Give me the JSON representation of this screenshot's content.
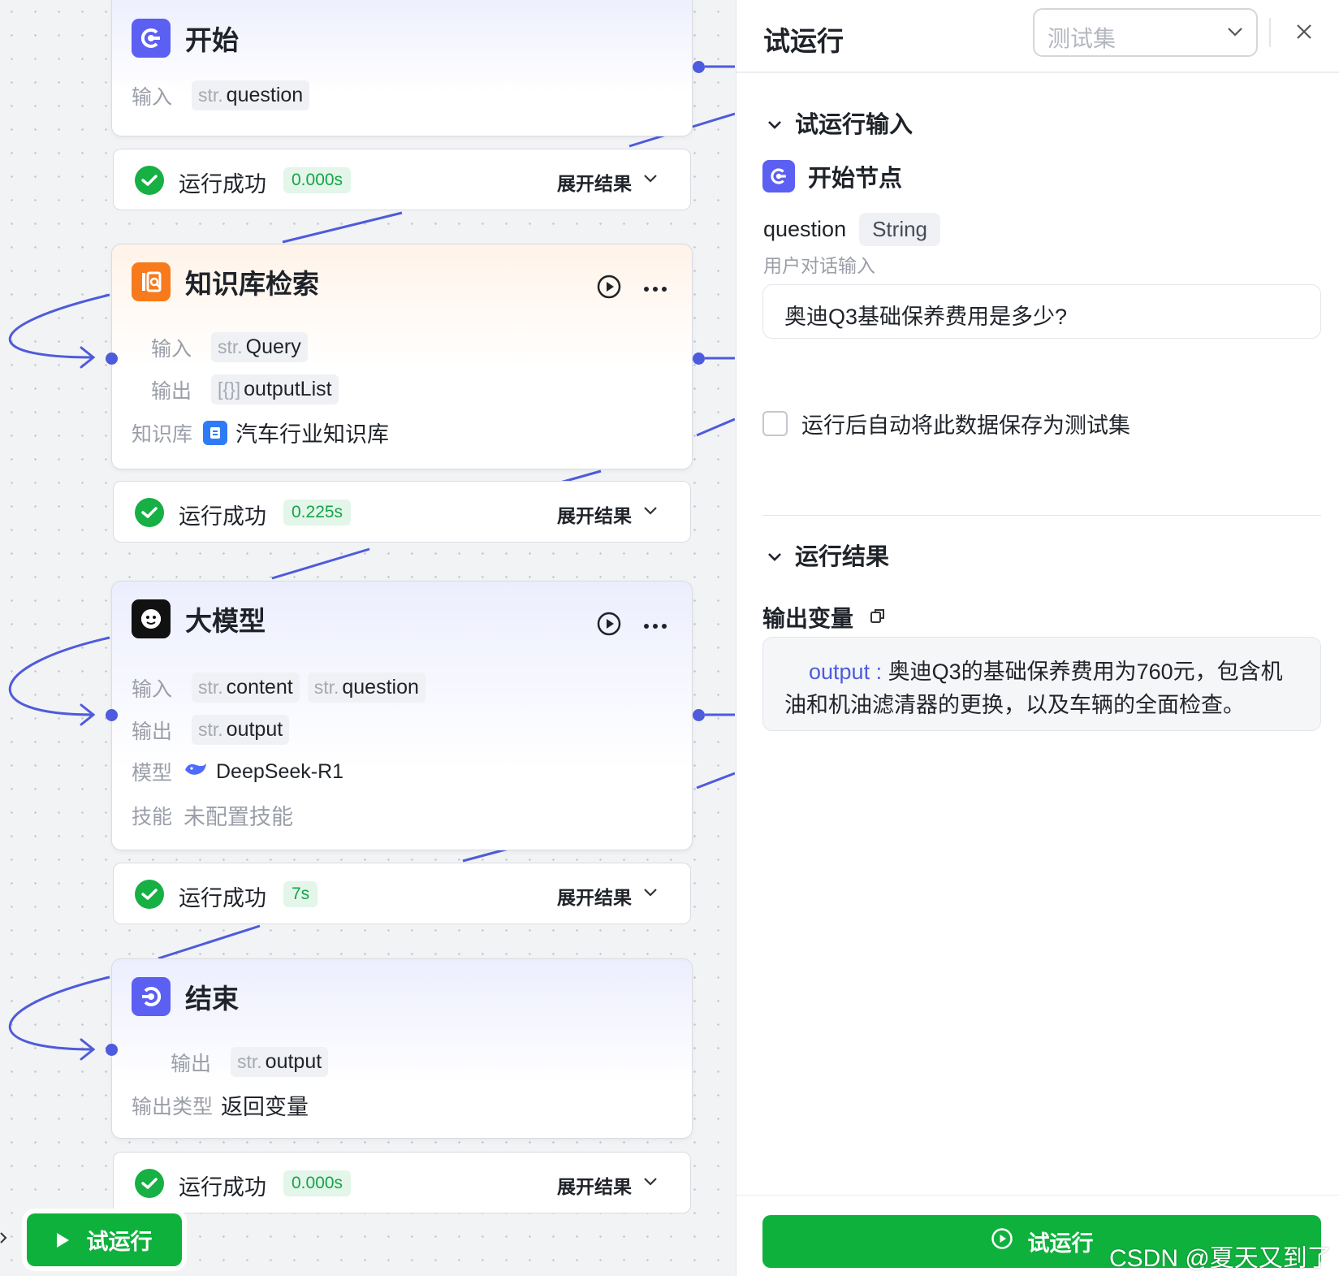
{
  "canvas": {
    "start": {
      "title": "开始",
      "input_label": "输入",
      "input_type": "str.",
      "input_name": "question"
    },
    "knowledge": {
      "title": "知识库检索",
      "input_label": "输入",
      "input_type": "str.",
      "input_name": "Query",
      "output_label": "输出",
      "output_type": "[{}]",
      "output_name": "outputList",
      "kb_label": "知识库",
      "kb_name": "汽车行业知识库"
    },
    "llm": {
      "title": "大模型",
      "input_label": "输入",
      "input_type_1": "str.",
      "input_name_1": "content",
      "input_type_2": "str.",
      "input_name_2": "question",
      "output_label": "输出",
      "output_type": "str.",
      "output_name": "output",
      "model_label": "模型",
      "model_name": "DeepSeek-R1",
      "skill_label": "技能",
      "skill_value": "未配置技能"
    },
    "end": {
      "title": "结束",
      "output_label": "输出",
      "output_type": "str.",
      "output_name": "output",
      "type_label": "输出类型",
      "type_value": "返回变量"
    },
    "statuses": [
      {
        "text": "运行成功",
        "time": "0.000s",
        "expand": "展开结果"
      },
      {
        "text": "运行成功",
        "time": "0.225s",
        "expand": "展开结果"
      },
      {
        "text": "运行成功",
        "time": "7s",
        "expand": "展开结果"
      },
      {
        "text": "运行成功",
        "time": "0.000s",
        "expand": "展开结果"
      }
    ],
    "run_button": "试运行"
  },
  "panel": {
    "title": "试运行",
    "testset_placeholder": "测试集",
    "input_section": "试运行输入",
    "start_node_label": "开始节点",
    "field_name": "question",
    "field_type": "String",
    "field_desc": "用户对话输入",
    "field_value": "奥迪Q3基础保养费用是多少?",
    "autosave_label": "运行后自动将此数据保存为测试集",
    "result_section": "运行结果",
    "output_var_label": "输出变量",
    "output_key": "output",
    "output_sep": " : ",
    "output_value": "奥迪Q3的基础保养费用为760元，包含机油和机油滤清器的更换，以及车辆的全面检查。",
    "run_button": "试运行"
  },
  "watermark": "CSDN @夏天又到了",
  "colors": {
    "accent": "#4e5bdc",
    "success": "#0fb13d",
    "kb_orange": "#f77a1d"
  }
}
